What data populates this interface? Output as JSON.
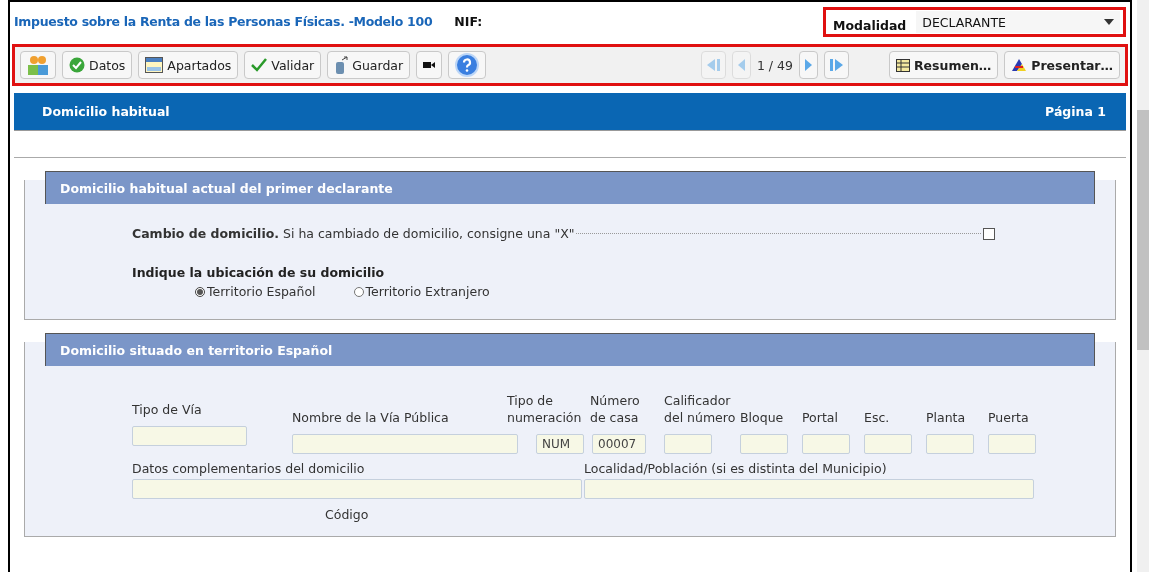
{
  "header": {
    "title": "Impuesto sobre la Renta de las Personas Físicas. -Modelo 100",
    "nif_label": "NIF:",
    "modalidad": {
      "label": "Modalidad",
      "value": "DECLARANTE"
    }
  },
  "toolbar": {
    "left": [
      {
        "kind": "people"
      },
      {
        "kind": "check-circle",
        "label": "Datos"
      },
      {
        "kind": "grid",
        "label": "Apartados"
      },
      {
        "kind": "tick",
        "label": "Validar"
      },
      {
        "kind": "save",
        "label": "Guardar"
      },
      {
        "kind": "video"
      },
      {
        "kind": "help"
      }
    ],
    "nav": [
      {
        "kind": "first",
        "disabled": true
      },
      {
        "kind": "prev",
        "disabled": true
      },
      {
        "kind": "next",
        "disabled": false
      },
      {
        "kind": "last",
        "disabled": false
      }
    ],
    "page": "1 / 49",
    "right": [
      {
        "kind": "table",
        "label": "Resumen…"
      },
      {
        "kind": "logo",
        "label": "Presentar…"
      }
    ]
  },
  "page_bar": {
    "title": "Domicilio habitual",
    "page": "Página 1"
  },
  "sections": [
    {
      "kind": "location",
      "title": "Domicilio habitual actual del primer declarante",
      "change": {
        "text": "**Cambio de domicilio.** Si ha cambiado de domicilio, consigne una \"X\"",
        "checked": false
      },
      "question": "Indique la ubicación de su domicilio",
      "options": [
        {
          "label": "Territorio Español",
          "selected": true
        },
        {
          "label": "Territorio Extranjero",
          "selected": false
        }
      ]
    },
    {
      "kind": "address",
      "title": "Domicilio situado en territorio Español",
      "fields": [
        {
          "label": "Tipo de Vía"
        },
        {
          "label": "Nombre de la Vía Pública"
        },
        {
          "label": "Tipo de numeración",
          "value": "NUM"
        },
        {
          "label": "Número de casa",
          "value": "00007"
        },
        {
          "label": "Calificador del número"
        },
        {
          "label": "Bloque"
        },
        {
          "label": "Portal"
        },
        {
          "label": "Esc."
        },
        {
          "label": "Planta"
        },
        {
          "label": "Puerta"
        }
      ],
      "fields2": [
        {
          "label": "Datos complementarios del domicilio"
        },
        {
          "label": "Localidad/Población (si es distinta del Municipio)"
        }
      ],
      "next_label": "Código"
    }
  ]
}
